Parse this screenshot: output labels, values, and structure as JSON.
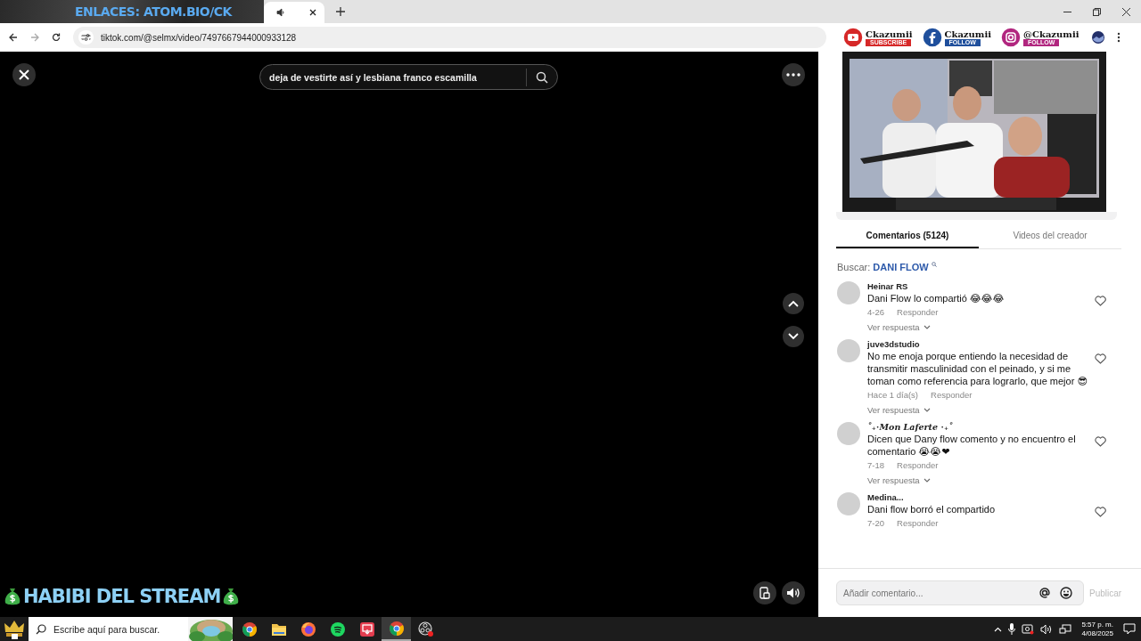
{
  "stream_overlay": {
    "top_banner": "ENLACES: ATOM.BIO/CK",
    "socials": [
      {
        "kind": "youtube",
        "name": "Ckazumii",
        "caption": "SUBSCRIBE"
      },
      {
        "kind": "facebook",
        "name": "Ckazumii",
        "caption": "FOLLOW"
      },
      {
        "kind": "instagram",
        "name": "@Ckazumii",
        "caption": "FOLLOW"
      }
    ],
    "bottom_title": "HABIBI DEL STREAM"
  },
  "browser": {
    "tab": {
      "audio": true
    },
    "url": "tiktok.com/@selmx/video/7497667944000933128"
  },
  "video": {
    "search": "deja de vestirte así y lesbiana franco escamilla"
  },
  "comments_panel": {
    "tabs": [
      {
        "label": "Comentarios (5124)",
        "selected": true
      },
      {
        "label": "Videos del creador",
        "selected": false
      }
    ],
    "search_label": "Buscar:",
    "search_term": "DANI FLOW",
    "comments": [
      {
        "user": "Heinar RS",
        "fancy": false,
        "text": "Dani Flow lo compartió 😂😂😂",
        "date": "4-26",
        "reply": "Responder",
        "view_replies": "Ver respuesta"
      },
      {
        "user": "juve3dstudio",
        "fancy": false,
        "text": "No me enoja porque entiendo la necesidad de transmitir masculinidad con el peinado, y si me toman como referencia para lograrlo, que mejor 😎",
        "date": "Hace 1 día(s)",
        "reply": "Responder",
        "view_replies": "Ver respuesta"
      },
      {
        "user": "˚₊⋅Mon Laferte ⋅₊˚",
        "fancy": true,
        "text": "Dicen que Dany flow comento y no encuentro el comentario 😭😭❤",
        "date": "7-18",
        "reply": "Responder",
        "view_replies": "Ver respuesta"
      },
      {
        "user": "Medina...",
        "fancy": false,
        "text": "Dani flow borró el compartido",
        "date": "7-20",
        "reply": "Responder"
      }
    ],
    "input": {
      "placeholder": "Añadir comentario...",
      "post": "Publicar"
    }
  },
  "taskbar": {
    "search_placeholder": "Escribe aquí para buscar.",
    "time": "5:57 p. m.",
    "date": "4/08/2025",
    "apps": [
      {
        "kind": "chrome",
        "selected": false
      },
      {
        "kind": "folder",
        "selected": false
      },
      {
        "kind": "firefox",
        "selected": false
      },
      {
        "kind": "spotify",
        "selected": false
      },
      {
        "kind": "screen",
        "selected": false
      },
      {
        "kind": "chrome",
        "selected": true
      },
      {
        "kind": "obs",
        "selected": false
      }
    ]
  }
}
